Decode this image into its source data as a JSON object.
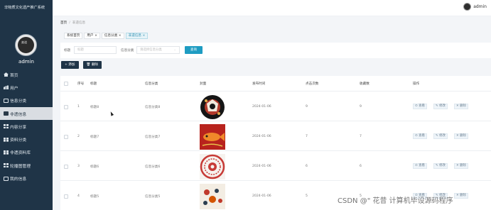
{
  "sidebar": {
    "brand": "非物质文化遗产推广系统",
    "avatar_text": "楽道",
    "username": "admin",
    "items": [
      {
        "label": "首页",
        "icon": "home-icon",
        "active": false
      },
      {
        "label": "用户",
        "icon": "users-icon",
        "active": false
      },
      {
        "label": "信息分类",
        "icon": "category-icon",
        "active": false
      },
      {
        "label": "非遗信息",
        "icon": "shop-icon",
        "active": true
      },
      {
        "label": "内容分享",
        "icon": "grid-icon",
        "active": false
      },
      {
        "label": "资料分类",
        "icon": "grid-icon",
        "active": false
      },
      {
        "label": "非遗资料库",
        "icon": "grid-icon",
        "active": false
      },
      {
        "label": "轮播图管理",
        "icon": "grid-icon",
        "active": false
      },
      {
        "label": "我的信息",
        "icon": "profile-icon",
        "active": false
      }
    ]
  },
  "topbar": {
    "username": "admin"
  },
  "breadcrumb": {
    "home": "首页",
    "separator": "/",
    "current": "非遗信息"
  },
  "tabs": [
    {
      "label": "系统首页",
      "closable": false,
      "active": false
    },
    {
      "label": "用户",
      "closable": true,
      "active": false
    },
    {
      "label": "信息分类",
      "closable": true,
      "active": false
    },
    {
      "label": "非遗信息",
      "closable": true,
      "active": true
    }
  ],
  "filter": {
    "title_label": "标题",
    "title_placeholder": "标题",
    "category_label": "信息分类",
    "category_placeholder": "请选择信息分类",
    "query_button": "查询"
  },
  "actions": {
    "add": "+ 添加",
    "delete": "删除"
  },
  "table": {
    "columns": [
      "序号",
      "标题",
      "信息分类",
      "封面",
      "发布时间",
      "点击次数",
      "收藏数",
      "操作"
    ],
    "rows": [
      {
        "index": "1",
        "title": "标题8",
        "category": "信息分类8",
        "cover": "cover-craft-black",
        "date": "2024-01-06",
        "clicks": "9",
        "favorites": "9"
      },
      {
        "index": "2",
        "title": "标题7",
        "category": "信息分类7",
        "cover": "cover-fish-red",
        "date": "2024-01-06",
        "clicks": "7",
        "favorites": "7"
      },
      {
        "index": "3",
        "title": "标题6",
        "category": "信息分类6",
        "cover": "cover-papercut-circle",
        "date": "2024-01-06",
        "clicks": "6",
        "favorites": "6"
      },
      {
        "index": "4",
        "title": "标题5",
        "category": "信息分类5",
        "cover": "cover-papercut-figures",
        "date": "2024-01-06",
        "clicks": "5",
        "favorites": "5"
      }
    ],
    "row_actions": {
      "view": "查看",
      "edit": "修改",
      "delete": "删除"
    }
  },
  "watermark": "CSDN @\" 花昔  计算机毕设源码程序",
  "colors": {
    "sidebar_bg": "#1f3447",
    "accent": "#1e9cc2",
    "content_bg": "#f3f5f8"
  }
}
